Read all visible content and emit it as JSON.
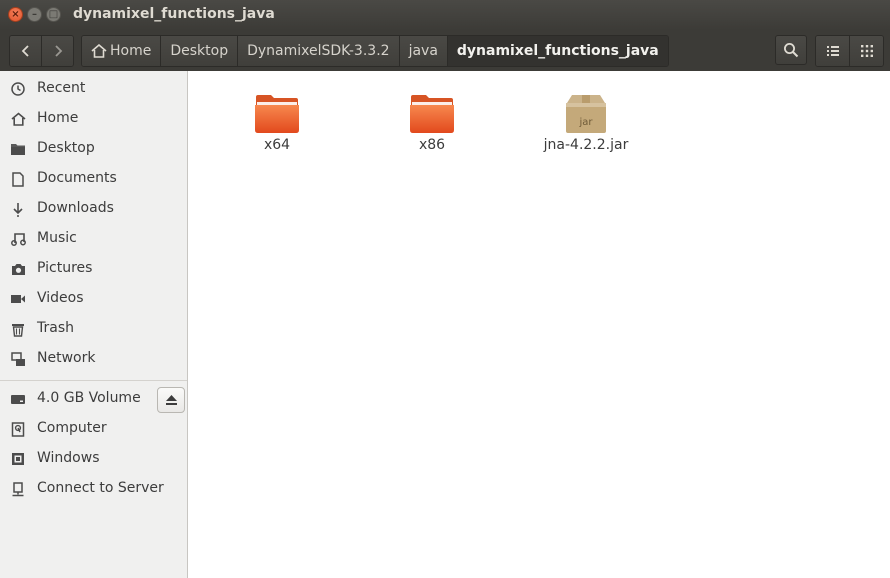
{
  "window": {
    "title": "dynamixel_functions_java",
    "controls": [
      "close",
      "minimize",
      "maximize"
    ]
  },
  "toolbar": {
    "back_icon": "chevron-left-icon",
    "forward_icon": "chevron-right-icon",
    "breadcrumbs": [
      {
        "label": "Home",
        "icon": "home-icon"
      },
      {
        "label": "Desktop"
      },
      {
        "label": "DynamixelSDK-3.3.2"
      },
      {
        "label": "java"
      },
      {
        "label": "dynamixel_functions_java",
        "active": true
      }
    ],
    "search_icon": "search-icon",
    "list_view_icon": "list-view-icon",
    "grid_view_icon": "grid-view-icon"
  },
  "sidebar": {
    "places": [
      {
        "label": "Recent",
        "icon": "clock-icon"
      },
      {
        "label": "Home",
        "icon": "home-icon"
      },
      {
        "label": "Desktop",
        "icon": "folder-icon"
      },
      {
        "label": "Documents",
        "icon": "document-icon"
      },
      {
        "label": "Downloads",
        "icon": "download-icon"
      },
      {
        "label": "Music",
        "icon": "music-icon"
      },
      {
        "label": "Pictures",
        "icon": "camera-icon"
      },
      {
        "label": "Videos",
        "icon": "video-icon"
      },
      {
        "label": "Trash",
        "icon": "trash-icon"
      },
      {
        "label": "Network",
        "icon": "network-icon"
      }
    ],
    "devices": [
      {
        "label": "4.0 GB Volume",
        "icon": "drive-icon",
        "eject_icon": "eject-icon"
      },
      {
        "label": "Computer",
        "icon": "computer-icon"
      },
      {
        "label": "Windows",
        "icon": "chip-icon"
      },
      {
        "label": "Connect to Server",
        "icon": "server-icon"
      }
    ]
  },
  "files": [
    {
      "name": "x64",
      "icon": "folder-icon"
    },
    {
      "name": "x86",
      "icon": "folder-icon"
    },
    {
      "name": "jna-4.2.2.jar",
      "icon": "jar-archive-icon",
      "icon_label": "jar"
    }
  ],
  "colors": {
    "titlebar": "#3c3b37",
    "sidebar_bg": "#f0f0ef",
    "folder_orange": "#e95420",
    "close_button": "#e2552c"
  }
}
